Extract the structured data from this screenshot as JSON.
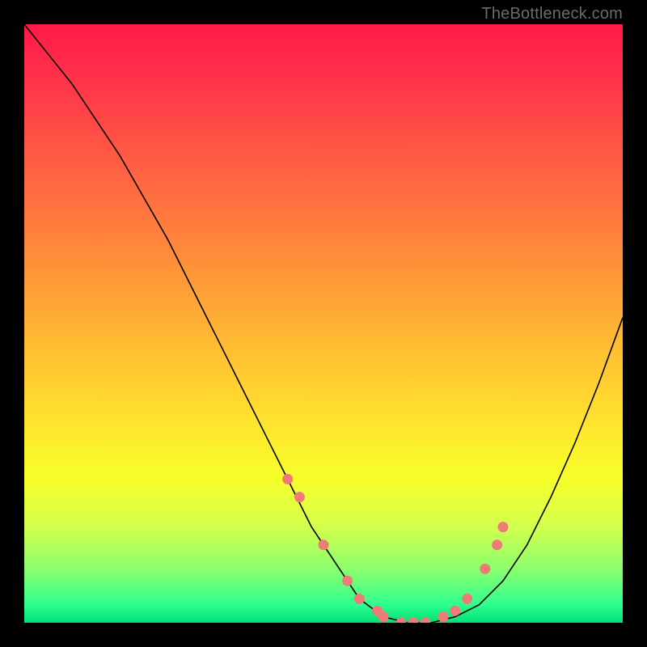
{
  "watermark": "TheBottleneck.com",
  "gradient_colors": {
    "top": "#ff1a48",
    "mid1": "#ff8a3a",
    "mid2": "#ffe22e",
    "bottom": "#00e078"
  },
  "dot_color": "#ef7a78",
  "curve_color": "#000000",
  "chart_data": {
    "type": "line",
    "title": "",
    "xlabel": "",
    "ylabel": "",
    "xlim": [
      0,
      100
    ],
    "ylim": [
      0,
      100
    ],
    "series": [
      {
        "name": "bottleneck-curve",
        "x": [
          0,
          4,
          8,
          12,
          16,
          20,
          24,
          28,
          32,
          36,
          40,
          44,
          48,
          52,
          56,
          60,
          64,
          68,
          72,
          76,
          80,
          84,
          88,
          92,
          96,
          100
        ],
        "values": [
          100,
          95,
          90,
          84,
          78,
          71,
          64,
          56,
          48,
          40,
          32,
          24,
          16,
          10,
          4,
          1,
          0,
          0,
          1,
          3,
          7,
          13,
          21,
          30,
          40,
          51
        ]
      }
    ],
    "markers": {
      "name": "highlight-dots",
      "x": [
        44,
        46,
        50,
        54,
        56,
        59,
        60,
        63,
        65,
        67,
        70,
        72,
        74,
        77,
        79,
        80
      ],
      "values": [
        24,
        21,
        13,
        7,
        4,
        2,
        1,
        0,
        0,
        0,
        1,
        2,
        4,
        9,
        13,
        16
      ]
    }
  }
}
